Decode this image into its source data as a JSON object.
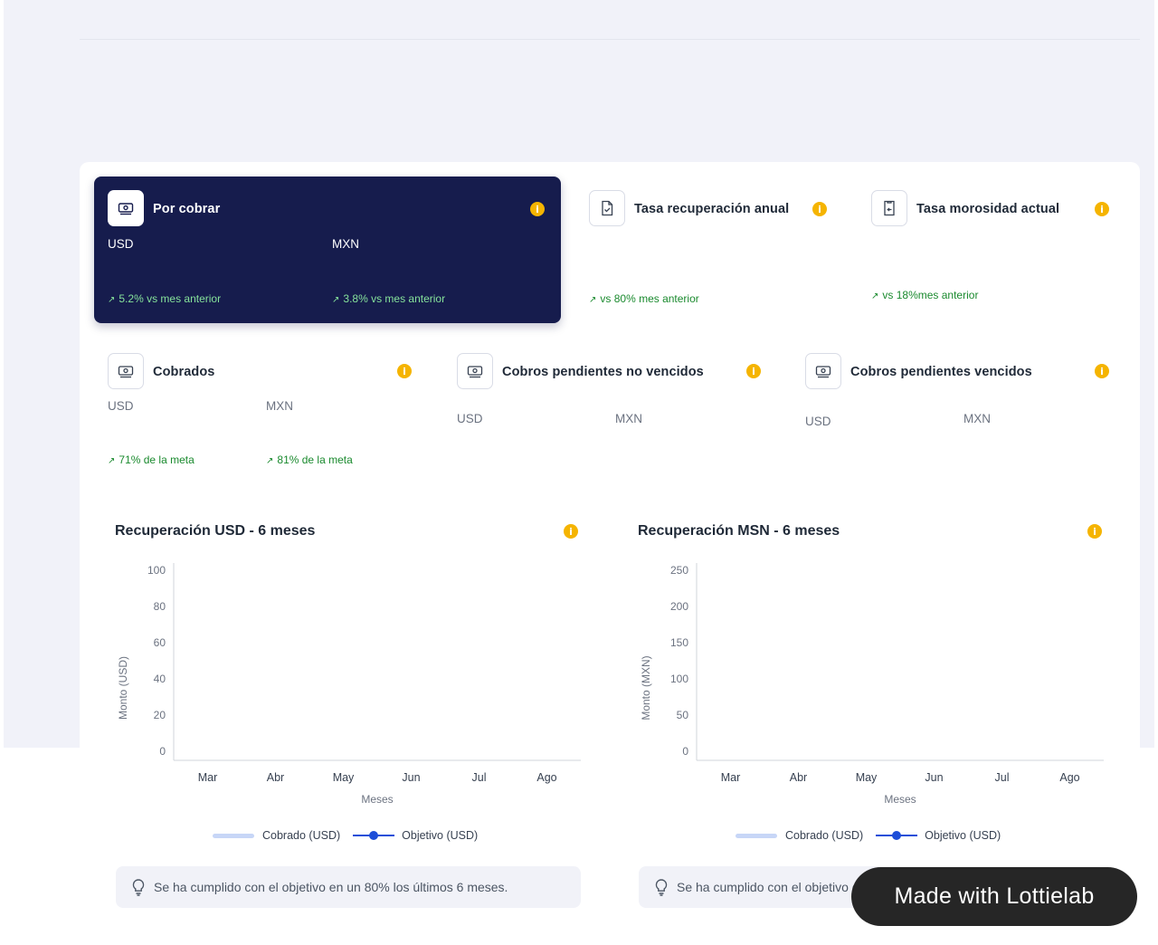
{
  "kpis": {
    "por_cobrar": {
      "title": "Por cobrar",
      "usd_label": "USD",
      "mxn_label": "MXN",
      "usd_trend": "5.2% vs mes anterior",
      "mxn_trend": "3.8% vs mes anterior",
      "icon": "banknote-icon"
    },
    "tasa_recuperacion": {
      "title": "Tasa recuperación anual",
      "trend": "vs 80% mes anterior",
      "icon": "document-check-icon"
    },
    "tasa_morosidad": {
      "title": "Tasa morosidad actual",
      "trend": "vs 18%mes anterior",
      "icon": "document-return-icon"
    },
    "cobrados": {
      "title": "Cobrados",
      "usd_label": "USD",
      "mxn_label": "MXN",
      "usd_trend": "71% de la meta",
      "mxn_trend": "81% de la meta",
      "icon": "banknote-icon"
    },
    "pendientes_no_vencidos": {
      "title": "Cobros pendientes no vencidos",
      "usd_label": "USD",
      "mxn_label": "MXN",
      "icon": "banknote-icon"
    },
    "pendientes_vencidos": {
      "title": "Cobros pendientes vencidos",
      "usd_label": "USD",
      "mxn_label": "MXN",
      "icon": "banknote-icon"
    }
  },
  "chart_data": [
    {
      "type": "bar",
      "title": "Recuperación USD - 6 meses",
      "categories": [
        "Mar",
        "Abr",
        "May",
        "Jun",
        "Jul",
        "Ago"
      ],
      "xlabel": "Meses",
      "ylabel": "Monto (USD)",
      "yticks": [
        0,
        20,
        40,
        60,
        80,
        100
      ],
      "ylim": [
        0,
        100
      ],
      "grid": false,
      "legend_position": "bottom",
      "series": [
        {
          "name": "Cobrado (USD)",
          "type": "bar",
          "values": [],
          "color": "#c7d6f7"
        },
        {
          "name": "Objetivo (USD)",
          "type": "line",
          "values": [],
          "color": "#1d4ed8"
        }
      ]
    },
    {
      "type": "bar",
      "title": "Recuperación MSN - 6 meses",
      "categories": [
        "Mar",
        "Abr",
        "May",
        "Jun",
        "Jul",
        "Ago"
      ],
      "xlabel": "Meses",
      "ylabel": "Monto (MXN)",
      "yticks": [
        0,
        50,
        100,
        150,
        200,
        250
      ],
      "ylim": [
        0,
        250
      ],
      "grid": false,
      "legend_position": "bottom",
      "series": [
        {
          "name": "Cobrado (USD)",
          "type": "bar",
          "values": [],
          "color": "#c7d6f7"
        },
        {
          "name": "Objetivo (USD)",
          "type": "line",
          "values": [],
          "color": "#1d4ed8"
        }
      ]
    }
  ],
  "tips": {
    "usd": "Se ha cumplido con el objetivo en un 80% los últimos 6 meses.",
    "mxn": "Se ha cumplido con el objetivo en un 90% los últimos 6 meses."
  },
  "badge": {
    "text": "Made with Lottielab"
  },
  "colors": {
    "dark_card": "#161c4d",
    "info": "#f5b400",
    "trend_green": "#1a8a2e",
    "accent_blue": "#1d4ed8"
  }
}
